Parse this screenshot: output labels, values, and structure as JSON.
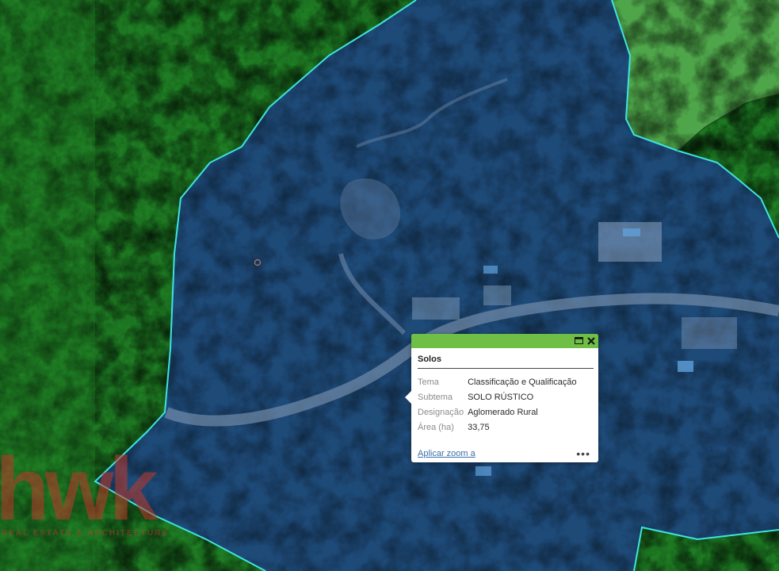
{
  "popup": {
    "title": "Solos",
    "fields": [
      {
        "label": "Tema",
        "value": "Classificação e Qualificação"
      },
      {
        "label": "Subtema",
        "value": "SOLO RÚSTICO"
      },
      {
        "label": "Designação",
        "value": "Aglomerado Rural"
      },
      {
        "label": "Área (ha)",
        "value": "33,75"
      }
    ],
    "zoom_link": "Aplicar zoom a",
    "more_label": "•••",
    "header_color": "#6fbe45"
  },
  "watermark": {
    "logo_text": "hwk",
    "tagline": "REAL ESTATE & ARCHITECTURE"
  },
  "colors": {
    "forest_zone": "#1f7d24",
    "selected_zone": "#1e4a78",
    "light_zone": "#4fa64a",
    "boundary": "#3fe3e0"
  }
}
